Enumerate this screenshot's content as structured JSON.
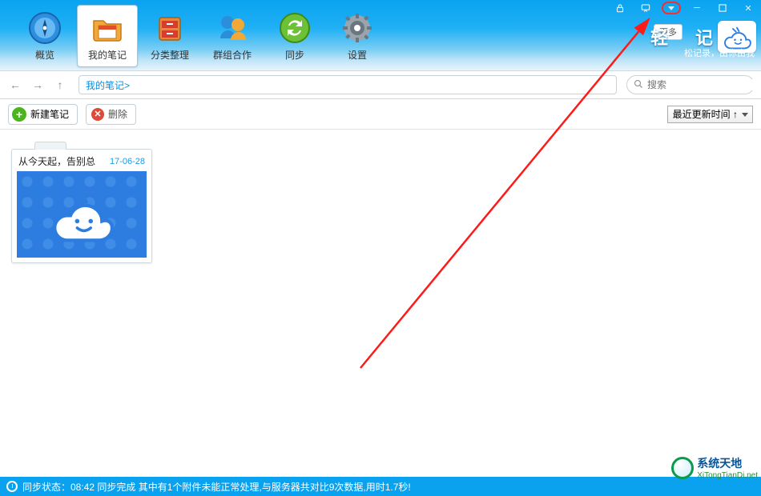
{
  "toolbar": {
    "items": [
      {
        "id": "overview",
        "label": "概览"
      },
      {
        "id": "my-notes",
        "label": "我的笔记"
      },
      {
        "id": "categorize",
        "label": "分类整理"
      },
      {
        "id": "groups",
        "label": "群组合作"
      },
      {
        "id": "sync",
        "label": "同步"
      },
      {
        "id": "settings",
        "label": "设置"
      }
    ],
    "active_index": 1
  },
  "brand": {
    "text_left": "轻",
    "text_right": "记",
    "sub": "松记录，由你由我",
    "more": "更多"
  },
  "nav": {
    "breadcrumb": "我的笔记>",
    "search_placeholder": "搜索"
  },
  "actions": {
    "new_label": "新建笔记",
    "delete_label": "删除",
    "sort_label": "最近更新时间 ↑"
  },
  "content": {
    "notes": [
      {
        "title": "从今天起，告别总",
        "date": "17-06-28"
      }
    ]
  },
  "status": {
    "text": "同步状态：08:42 同步完成 其中有1个附件未能正常处理,与服务器共对比9次数据,用时1.7秒!"
  },
  "watermark": {
    "title": "系统天地",
    "url": "XiTongTianDi.net"
  }
}
